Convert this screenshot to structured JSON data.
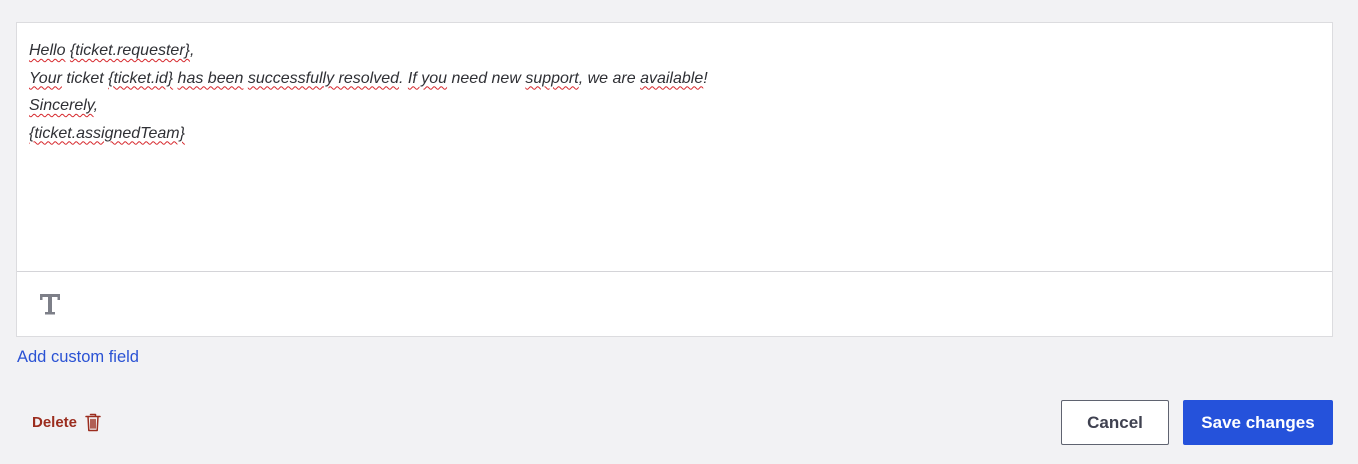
{
  "editor": {
    "lines": [
      [
        {
          "text": "Hello",
          "misspelled": true
        },
        {
          "text": " ",
          "misspelled": false
        },
        {
          "text": "{ticket.requester}",
          "misspelled": true
        },
        {
          "text": ",",
          "misspelled": false
        }
      ],
      [
        {
          "text": "Your",
          "misspelled": true
        },
        {
          "text": " ticket ",
          "misspelled": false
        },
        {
          "text": "{ticket.id}",
          "misspelled": true
        },
        {
          "text": " ",
          "misspelled": false
        },
        {
          "text": "has been",
          "misspelled": true
        },
        {
          "text": " ",
          "misspelled": false
        },
        {
          "text": "successfully resolved",
          "misspelled": true
        },
        {
          "text": ". ",
          "misspelled": false
        },
        {
          "text": "If you",
          "misspelled": true
        },
        {
          "text": " need new ",
          "misspelled": false
        },
        {
          "text": "support",
          "misspelled": true
        },
        {
          "text": ", we are ",
          "misspelled": false
        },
        {
          "text": "available",
          "misspelled": true
        },
        {
          "text": "!",
          "misspelled": false
        }
      ],
      [
        {
          "text": "Sincerely",
          "misspelled": true
        },
        {
          "text": ",",
          "misspelled": false
        }
      ],
      [
        {
          "text": "{ticket.assignedTeam}",
          "misspelled": true
        }
      ]
    ]
  },
  "toolbar": {
    "text_format_icon": "text-format-icon",
    "text_format_glyph": "T"
  },
  "links": {
    "add_custom_field": "Add custom field"
  },
  "actions": {
    "delete_label": "Delete",
    "delete_icon": "trash-icon",
    "cancel_label": "Cancel",
    "save_label": "Save changes"
  },
  "colors": {
    "page_background": "#f2f2f4",
    "editor_background": "#ffffff",
    "body_text": "#2f3035",
    "spellcheck_underline": "#d6262b",
    "link": "#2a52d4",
    "danger": "#9b2d1e",
    "primary_button": "#2552db",
    "secondary_border": "#5f6370",
    "toolbar_icon": "#7d7f88"
  }
}
